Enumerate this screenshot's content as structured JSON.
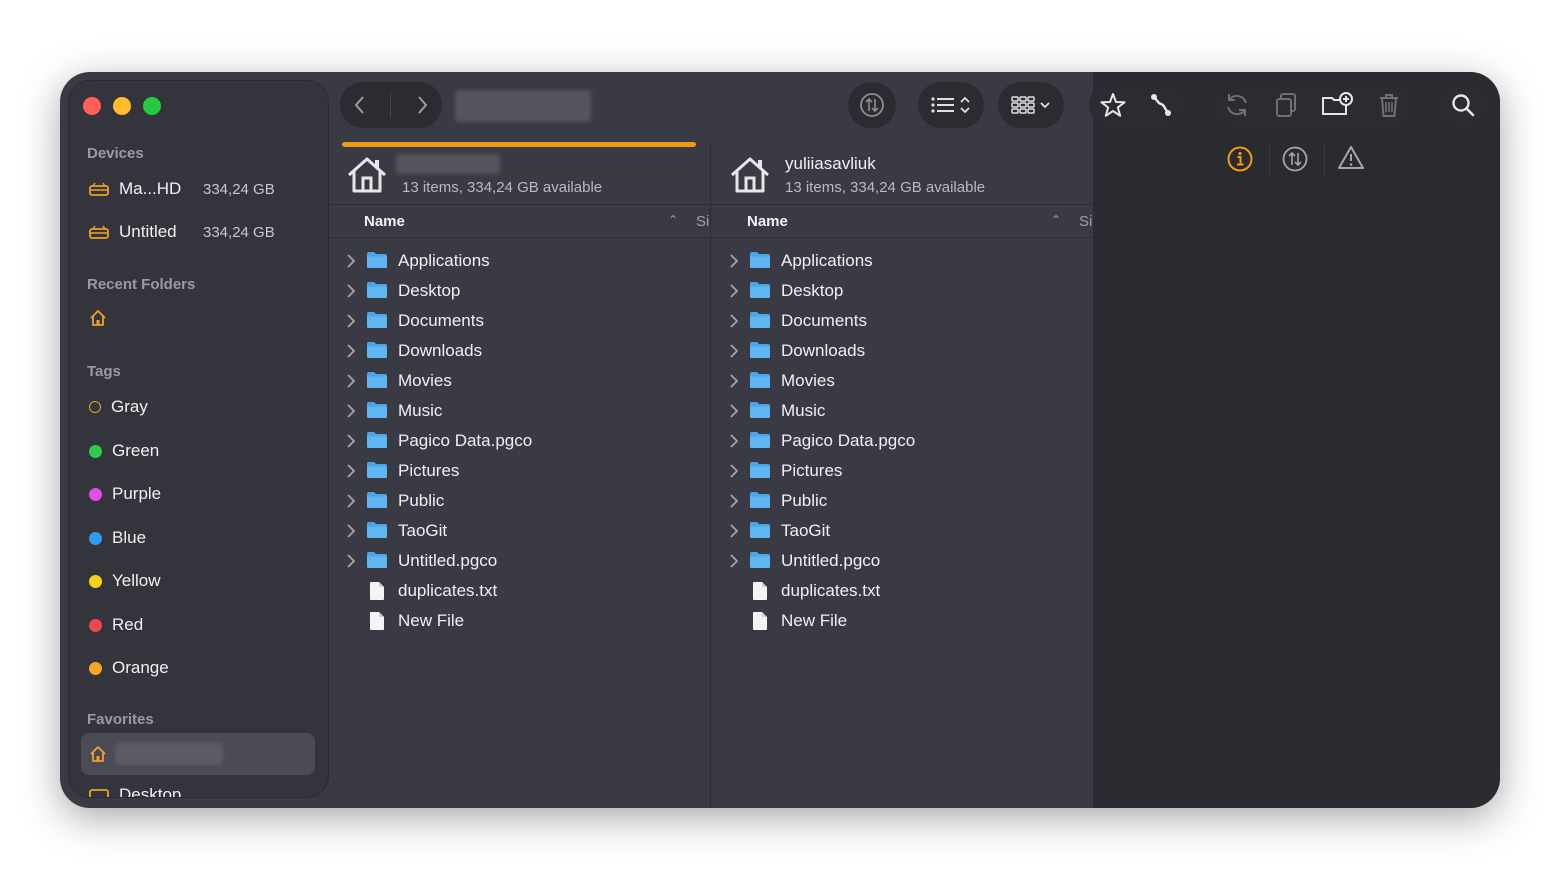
{
  "sidebar": {
    "devices_title": "Devices",
    "devices": [
      {
        "name": "Ma...HD",
        "capacity": "334,24 GB"
      },
      {
        "name": "Untitled",
        "capacity": "334,24 GB"
      }
    ],
    "recent_title": "Recent Folders",
    "tags_title": "Tags",
    "tags": [
      {
        "label": "Gray",
        "color": "#f0a02a",
        "hollow": true
      },
      {
        "label": "Green",
        "color": "#2ecc4a"
      },
      {
        "label": "Purple",
        "color": "#e14ee8"
      },
      {
        "label": "Blue",
        "color": "#2e9cf0"
      },
      {
        "label": "Yellow",
        "color": "#f5d417"
      },
      {
        "label": "Red",
        "color": "#f2474f"
      },
      {
        "label": "Orange",
        "color": "#f5a623"
      }
    ],
    "favorites_title": "Favorites",
    "favorites_next": "Desktop"
  },
  "left_pane": {
    "title": "",
    "subtitle": "13 items, 334,24 GB available",
    "name_header": "Name",
    "size_header": "Si",
    "items": [
      {
        "name": "Applications",
        "type": "folder"
      },
      {
        "name": "Desktop",
        "type": "folder"
      },
      {
        "name": "Documents",
        "type": "folder"
      },
      {
        "name": "Downloads",
        "type": "folder"
      },
      {
        "name": "Movies",
        "type": "folder"
      },
      {
        "name": "Music",
        "type": "folder"
      },
      {
        "name": "Pagico Data.pgco",
        "type": "folder"
      },
      {
        "name": "Pictures",
        "type": "folder"
      },
      {
        "name": "Public",
        "type": "folder"
      },
      {
        "name": "TaoGit",
        "type": "folder"
      },
      {
        "name": "Untitled.pgco",
        "type": "folder"
      },
      {
        "name": "duplicates.txt",
        "type": "file"
      },
      {
        "name": "New File",
        "type": "file"
      }
    ]
  },
  "right_pane": {
    "title": "yuliiasavliuk",
    "subtitle": "13 items, 334,24 GB available",
    "name_header": "Name",
    "size_header": "Si",
    "items": [
      {
        "name": "Applications",
        "type": "folder"
      },
      {
        "name": "Desktop",
        "type": "folder"
      },
      {
        "name": "Documents",
        "type": "folder"
      },
      {
        "name": "Downloads",
        "type": "folder"
      },
      {
        "name": "Movies",
        "type": "folder"
      },
      {
        "name": "Music",
        "type": "folder"
      },
      {
        "name": "Pagico Data.pgco",
        "type": "folder"
      },
      {
        "name": "Pictures",
        "type": "folder"
      },
      {
        "name": "Public",
        "type": "folder"
      },
      {
        "name": "TaoGit",
        "type": "folder"
      },
      {
        "name": "Untitled.pgco",
        "type": "folder"
      },
      {
        "name": "duplicates.txt",
        "type": "file"
      },
      {
        "name": "New File",
        "type": "file"
      }
    ]
  },
  "colors": {
    "accent": "#f19a14",
    "folder": "#4aa6e8",
    "sidebar_icon": "#f0a02a"
  },
  "icons": {
    "toolbar": [
      "chevron-left-icon",
      "chevron-right-icon",
      "sync-icon",
      "list-view-icon",
      "grid-view-icon",
      "star-icon",
      "connect-icon",
      "refresh-icon",
      "copy-icon",
      "new-folder-icon",
      "trash-icon",
      "search-icon"
    ],
    "inspector": [
      "info-icon",
      "sync-icon",
      "warning-icon"
    ]
  }
}
